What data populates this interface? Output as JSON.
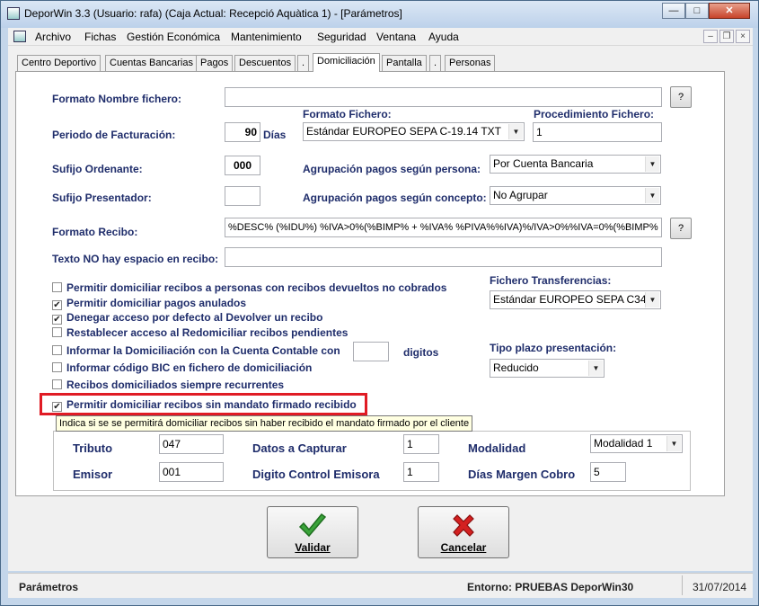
{
  "window": {
    "title": "DeporWin 3.3  (Usuario: rafa)  (Caja Actual: Recepció Aquàtica 1) - [Parámetros]",
    "caption_min": "—",
    "caption_max": "□",
    "caption_close": "✕"
  },
  "menu": [
    "Archivo",
    "Fichas",
    "Gestión Económica",
    "Mantenimiento",
    "Seguridad",
    "Ventana",
    "Ayuda"
  ],
  "mdi": {
    "min": "–",
    "restore": "❐",
    "close": "×"
  },
  "tabs": [
    "Centro Deportivo",
    "Cuentas Bancarias",
    "Pagos",
    "Descuentos",
    ".",
    "Domiciliación",
    "Pantalla",
    ".",
    "Personas"
  ],
  "active_tab": "Domiciliación",
  "form": {
    "formato_nombre_label": "Formato Nombre fichero:",
    "formato_nombre_value": "",
    "help_btn": "?",
    "periodo_label": "Periodo de Facturación:",
    "periodo_value": "90",
    "periodo_unit": "Días",
    "formato_fichero_label": "Formato Fichero:",
    "formato_fichero_value": "Estándar EUROPEO SEPA C-19.14 TXT",
    "procedimiento_label": "Procedimiento Fichero:",
    "procedimiento_value": "1",
    "sufijo_ord_label": "Sufijo Ordenante:",
    "sufijo_ord_value": "000",
    "agrup_persona_label": "Agrupación pagos según persona:",
    "agrup_persona_value": "Por Cuenta Bancaria",
    "sufijo_pres_label": "Sufijo Presentador:",
    "sufijo_pres_value": "",
    "agrup_concepto_label": "Agrupación pagos según concepto:",
    "agrup_concepto_value": "No Agrupar",
    "formato_recibo_label": "Formato Recibo:",
    "formato_recibo_value": "%DESC% (%IDU%) %IVA>0%(%BIMP% + %IVA% %PIVA%%IVA)%/IVA>0%%IVA=0%(%BIMP%",
    "texto_no_label": "Texto NO hay espacio en recibo:",
    "texto_no_value": "",
    "fichero_transf_label": "Fichero Transferencias:",
    "fichero_transf_value": "Estándar EUROPEO SEPA C34",
    "tipo_plazo_label": "Tipo plazo presentación:",
    "tipo_plazo_value": "Reducido",
    "digitos_label": "digitos",
    "digitos_value": ""
  },
  "checkboxes": [
    {
      "label": "Permitir domiciliar recibos a personas con recibos devueltos no cobrados",
      "checked": false
    },
    {
      "label": "Permitir domiciliar pagos anulados",
      "checked": true
    },
    {
      "label": "Denegar acceso por defecto al Devolver un recibo",
      "checked": true
    },
    {
      "label": "Restablecer acceso al Redomiciliar recibos pendientes",
      "checked": false
    },
    {
      "label": "Informar la Domiciliación con la Cuenta Contable con",
      "checked": false
    },
    {
      "label": "Informar código BIC en fichero de domiciliación",
      "checked": false
    },
    {
      "label": "Recibos domiciliados siempre recurrentes",
      "checked": false
    },
    {
      "label": "Permitir domiciliar recibos sin mandato firmado recibido",
      "checked": true
    }
  ],
  "check_mark": "✔",
  "tooltip": "Indica si se se permitirá domiciliar recibos sin haber recibido el mandato firmado por el cliente",
  "group": {
    "tributo_label": "Tributo",
    "tributo_value": "047",
    "datos_label": "Datos a Capturar",
    "datos_value": "1",
    "modalidad_label": "Modalidad",
    "modalidad_value": "Modalidad 1",
    "emisor_label": "Emisor",
    "emisor_value": "001",
    "digito_label": "Digito Control Emisora",
    "digito_value": "1",
    "dias_label": "Días Margen Cobro",
    "dias_value": "5"
  },
  "buttons": {
    "validar": "Validar",
    "cancelar": "Cancelar"
  },
  "status": {
    "left": "Parámetros",
    "entorno": "Entorno: PRUEBAS DeporWin30",
    "date": "31/07/2014"
  },
  "colors": {
    "label_blue": "#1f2d6b",
    "highlight_red": "#e01b24",
    "validar_green": "#3aa33a",
    "cancelar_red": "#d42020"
  }
}
